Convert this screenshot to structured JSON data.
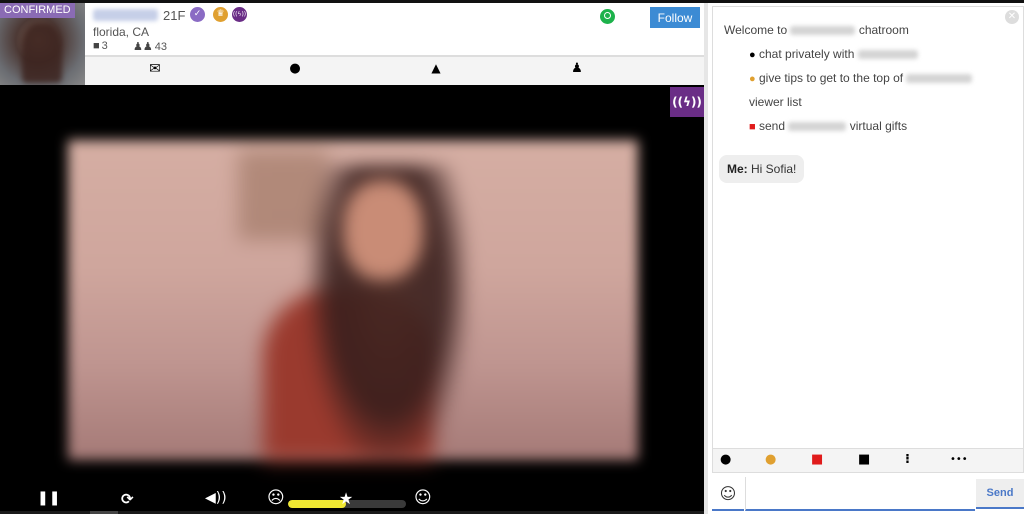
{
  "profile": {
    "badge_label": "CONFIRMED",
    "age_gender": "21F",
    "location": "florida, CA",
    "photo_count": "3",
    "follower_count": "43",
    "follow_label": "Follow"
  },
  "icons": {
    "verified": "✓",
    "crown": "♛",
    "signal": "((ϟ))",
    "camera": "📷",
    "group": "👥",
    "mail": "✉",
    "wink": "😜",
    "fire": "🔥",
    "user_add": "👤"
  },
  "video": {
    "signal_button": "((ϟ))",
    "rating_fraction": 0.49
  },
  "controls": {
    "pause": "❚❚",
    "refresh": "⟳",
    "volume": "🔊",
    "sad": "☹",
    "star": "★",
    "happy": "☺"
  },
  "chat": {
    "welcome_prefix": "Welcome to",
    "welcome_suffix": "chatroom",
    "line_private": "chat privately with",
    "line_tips": "give tips to get to the top of",
    "line_viewer": "viewer list",
    "line_send": "send",
    "line_gifts": "virtual gifts",
    "me_label": "Me:",
    "me_message": "Hi Sofia!",
    "close": "✕",
    "input_value": "",
    "send_label": "Send",
    "emoji": "☺",
    "toolbar": {
      "private": "💬",
      "tip": "●",
      "gift": "🎁",
      "camera": "📷",
      "split": "⁝",
      "more": "•••"
    }
  }
}
